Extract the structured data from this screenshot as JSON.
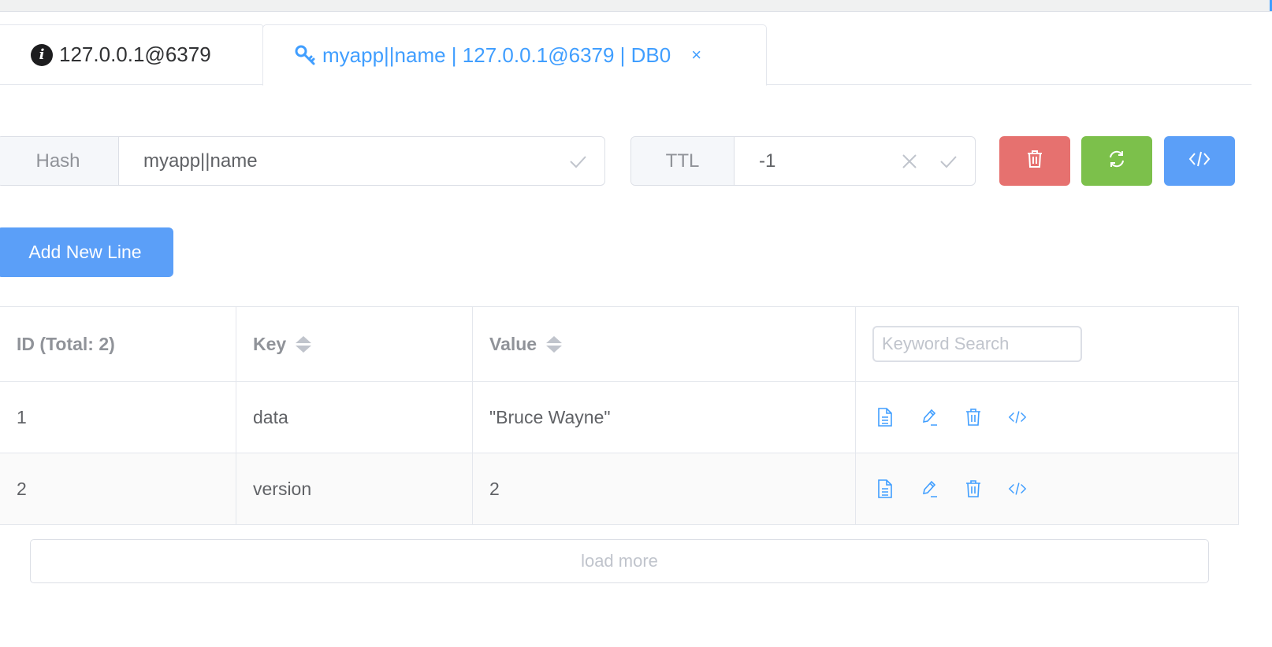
{
  "tabs": [
    {
      "label": "127.0.0.1@6379",
      "icon": "info-icon"
    },
    {
      "label": "myapp||name | 127.0.0.1@6379 | DB0",
      "icon": "key-icon",
      "close": "×"
    }
  ],
  "key_bar": {
    "type_label": "Hash",
    "key_value": "myapp||name",
    "ttl_label": "TTL",
    "ttl_value": "-1",
    "buttons": [
      "trash-icon",
      "refresh-icon",
      "code-icon"
    ],
    "colors": {
      "delete": "#e6716f",
      "refresh": "#7cc04b",
      "code": "#5b9ff8"
    }
  },
  "add_button": {
    "label": "Add New Line"
  },
  "table": {
    "headers": {
      "id": "ID (Total: 2)",
      "key": "Key",
      "value": "Value"
    },
    "search_placeholder": "Keyword Search",
    "rows": [
      {
        "id": "1",
        "key": "data",
        "value": "\"Bruce Wayne\""
      },
      {
        "id": "2",
        "key": "version",
        "value": "2"
      }
    ],
    "row_actions": [
      "document-icon",
      "edit-icon",
      "trash-icon",
      "code-icon"
    ]
  },
  "load_more": {
    "label": "load more"
  },
  "colors": {
    "accent": "#409eff"
  }
}
